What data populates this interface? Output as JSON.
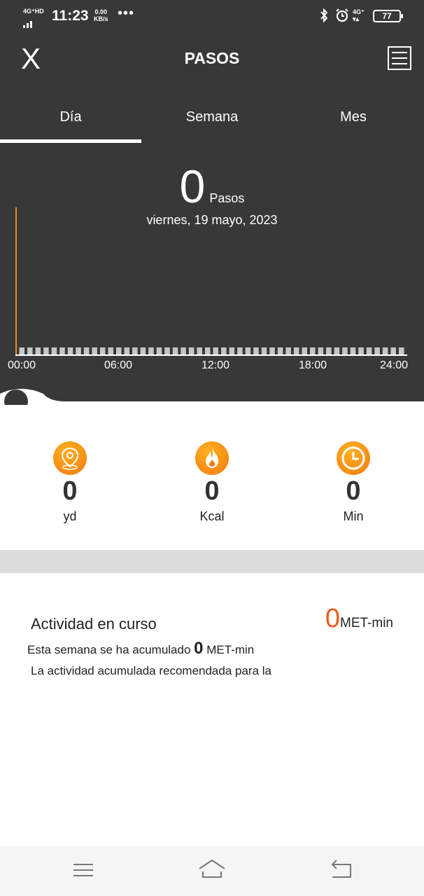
{
  "status_bar": {
    "network_label": "4G⁺HD",
    "time": "11:23",
    "speed_value": "0.00",
    "speed_unit": "KB/s",
    "overflow": "•••",
    "network_right": "4G⁺",
    "battery": "77"
  },
  "app_bar": {
    "close_label": "X",
    "title": "PASOS"
  },
  "tabs": [
    {
      "label": "Día",
      "active": true
    },
    {
      "label": "Semana",
      "active": false
    },
    {
      "label": "Mes",
      "active": false
    }
  ],
  "summary": {
    "steps": "0",
    "steps_unit": "Pasos",
    "date": "viernes, 19 mayo, 2023"
  },
  "chart_data": {
    "type": "bar",
    "x_ticks": [
      "00:00",
      "06:00",
      "12:00",
      "18:00",
      "24:00"
    ],
    "bar_count": 48,
    "values": [
      0,
      0,
      0,
      0,
      0,
      0,
      0,
      0,
      0,
      0,
      0,
      0,
      0,
      0,
      0,
      0,
      0,
      0,
      0,
      0,
      0,
      0,
      0,
      0,
      0,
      0,
      0,
      0,
      0,
      0,
      0,
      0,
      0,
      0,
      0,
      0,
      0,
      0,
      0,
      0,
      0,
      0,
      0,
      0,
      0,
      0,
      0,
      0
    ],
    "accent_color": "#f28a1e"
  },
  "metrics": [
    {
      "icon": "location-pin-icon",
      "value": "0",
      "unit": "yd"
    },
    {
      "icon": "flame-icon",
      "value": "0",
      "unit": "Kcal"
    },
    {
      "icon": "clock-icon",
      "value": "0",
      "unit": "Min"
    }
  ],
  "activity": {
    "title": "Actividad en curso",
    "value": "0",
    "unit": "MET-min",
    "week_prefix": "Esta semana se ha acumulado",
    "week_value": "0",
    "week_unit": "MET-min",
    "recommendation": "La actividad acumulada recomendada para la"
  },
  "colors": {
    "header_bg": "#383838",
    "accent": "#f47a10",
    "activity_value": "#ea5a1a"
  }
}
